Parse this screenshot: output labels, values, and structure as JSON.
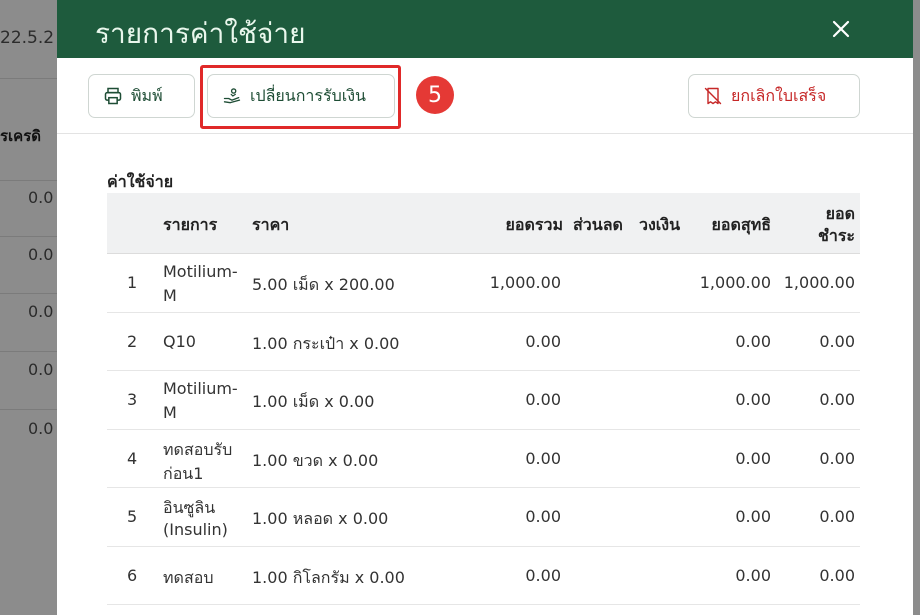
{
  "background": {
    "date_fragment": "22.5.2",
    "header_fragment": "รเครดิ",
    "values": [
      "0.0",
      "0.0",
      "0.0",
      "0.0",
      "0.0"
    ]
  },
  "modal": {
    "title": "รายการค่าใช้จ่าย",
    "toolbar": {
      "print_label": "พิมพ์",
      "change_payment_label": "เปลี่ยนการรับเงิน",
      "cancel_receipt_label": "ยกเลิกใบเสร็จ",
      "step_number": "5"
    },
    "section_label": "ค่าใช้จ่าย",
    "table": {
      "headers": {
        "no": "",
        "item": "รายการ",
        "price": "ราคา",
        "total": "ยอดรวม",
        "discount": "ส่วนลด",
        "credit": "วงเงิน",
        "net": "ยอดสุทธิ",
        "payable_line1": "ยอด",
        "payable_line2": "ชำระ"
      },
      "rows": [
        {
          "no": "1",
          "item_line1": "Motilium-",
          "item_line2": "M",
          "price": "5.00 เม็ด x 200.00",
          "total": "1,000.00",
          "discount": "",
          "credit": "",
          "net": "1,000.00",
          "payable": "1,000.00"
        },
        {
          "no": "2",
          "item_line1": "Q10",
          "item_line2": "",
          "price": "1.00 กระเป๋า x 0.00",
          "total": "0.00",
          "discount": "",
          "credit": "",
          "net": "0.00",
          "payable": "0.00"
        },
        {
          "no": "3",
          "item_line1": "Motilium-",
          "item_line2": "M",
          "price": "1.00 เม็ด x 0.00",
          "total": "0.00",
          "discount": "",
          "credit": "",
          "net": "0.00",
          "payable": "0.00"
        },
        {
          "no": "4",
          "item_line1": "ทดสอบรับ",
          "item_line2": "ก่อน1",
          "price": "1.00 ขวด x 0.00",
          "total": "0.00",
          "discount": "",
          "credit": "",
          "net": "0.00",
          "payable": "0.00"
        },
        {
          "no": "5",
          "item_line1": "อินซูลิน",
          "item_line2": "(Insulin)",
          "price": "1.00 หลอด x 0.00",
          "total": "0.00",
          "discount": "",
          "credit": "",
          "net": "0.00",
          "payable": "0.00"
        },
        {
          "no": "6",
          "item_line1": "ทดสอบ",
          "item_line2": "",
          "price": "1.00 กิโลกรัม x 0.00",
          "total": "0.00",
          "discount": "",
          "credit": "",
          "net": "0.00",
          "payable": "0.00"
        }
      ]
    }
  },
  "colors": {
    "header_bg": "#1e5b3d",
    "accent_green": "#1e4d35",
    "danger_red": "#c62828",
    "highlight_red": "#e02929"
  }
}
